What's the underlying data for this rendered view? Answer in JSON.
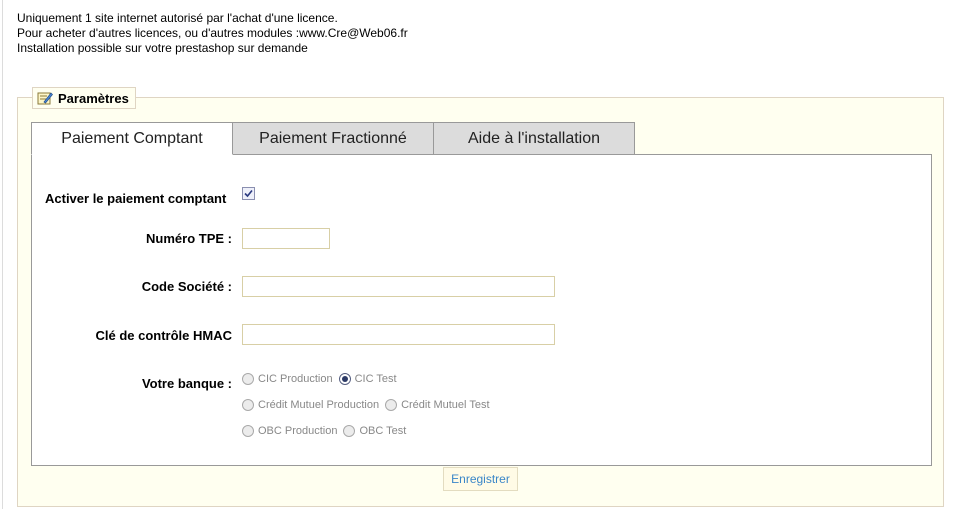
{
  "notice": {
    "line1": "Uniquement 1 site internet autorisé par l'achat d'une licence.",
    "line2": "Pour acheter d'autres licences, ou d'autres modules :www.Cre@Web06.fr",
    "line3": "Installation possible sur votre prestashop sur demande"
  },
  "fieldset": {
    "legend": "Paramètres",
    "legend_icon": "edit-note-icon"
  },
  "tabs": [
    {
      "label": "Paiement Comptant",
      "active": true
    },
    {
      "label": "Paiement Fractionné",
      "active": false
    },
    {
      "label": "Aide à l'installation",
      "active": false
    }
  ],
  "form": {
    "enable_label": "Activer le paiement comptant",
    "enable_checked": true,
    "tpe_label": "Numéro TPE :",
    "tpe_value": "",
    "company_label": "Code Société :",
    "company_value": "",
    "hmac_label": "Clé de contrôle HMAC",
    "hmac_value": "",
    "bank_label": "Votre banque :",
    "bank_options": [
      {
        "label": "CIC Production",
        "checked": false
      },
      {
        "label": "CIC Test",
        "checked": true
      },
      {
        "label": "Crédit Mutuel Production",
        "checked": false
      },
      {
        "label": "Crédit Mutuel Test",
        "checked": false
      },
      {
        "label": "OBC Production",
        "checked": false
      },
      {
        "label": "OBC Test",
        "checked": false
      }
    ]
  },
  "save_label": "Enregistrer",
  "colors": {
    "fieldset_bg": "#fffff0",
    "fieldset_border": "#dfd5c3",
    "tab_inactive": "#dcdcdc",
    "link_blue": "#3a86c8"
  }
}
